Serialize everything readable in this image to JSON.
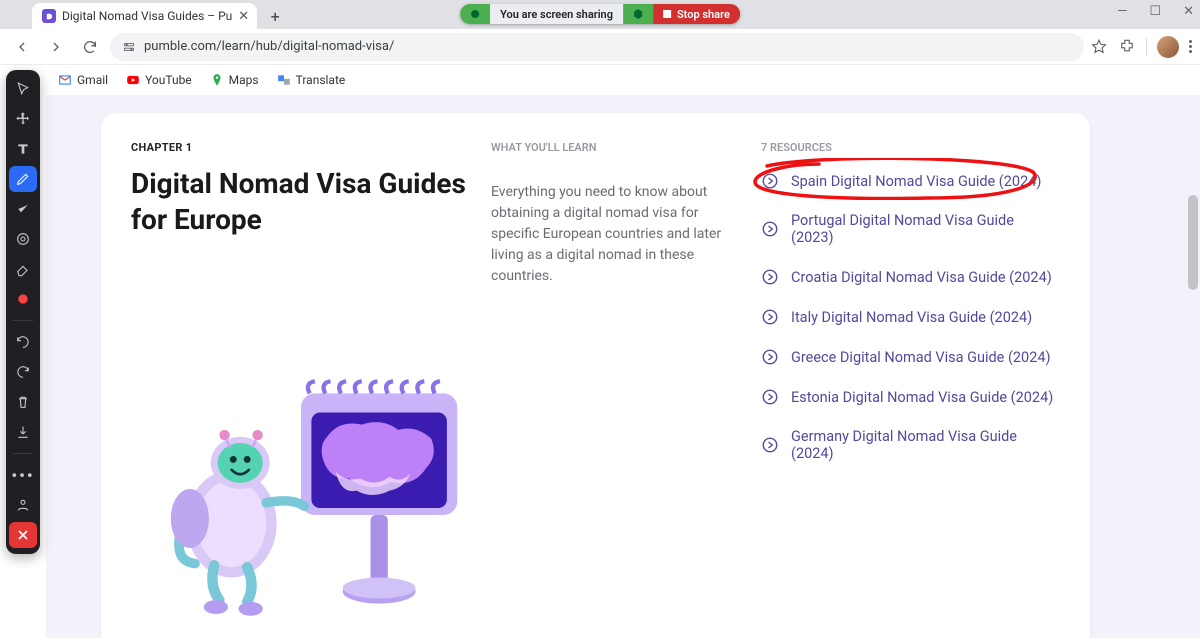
{
  "window": {
    "tab_title": "Digital Nomad Visa Guides – Pu",
    "minimize": "—",
    "maximize": "☐",
    "close": "✕"
  },
  "share": {
    "message": "You are screen sharing",
    "stop": "Stop share"
  },
  "browser": {
    "url": "pumble.com/learn/hub/digital-nomad-visa/"
  },
  "bookmarks": {
    "gmail": "Gmail",
    "youtube": "YouTube",
    "maps": "Maps",
    "translate": "Translate"
  },
  "page": {
    "chapter": "CHAPTER 1",
    "title": "Digital Nomad Visa Guides for Europe",
    "learn_label": "WHAT YOU'LL LEARN",
    "description": "Everything you need to know about obtaining a digital nomad visa for specific European countries and later living as a digital nomad in these countries.",
    "resources_label": "7 RESOURCES",
    "resources": [
      "Spain Digital Nomad Visa Guide (2024)",
      "Portugal Digital Nomad Visa Guide (2023)",
      "Croatia Digital Nomad Visa Guide (2024)",
      "Italy Digital Nomad Visa Guide (2024)",
      "Greece Digital Nomad Visa Guide (2024)",
      "Estonia Digital Nomad Visa Guide (2024)",
      "Germany Digital Nomad Visa Guide (2024)"
    ]
  },
  "colors": {
    "accent_purple": "#55479c",
    "page_bg": "#f5f1fb",
    "highlight_red": "#e11"
  }
}
